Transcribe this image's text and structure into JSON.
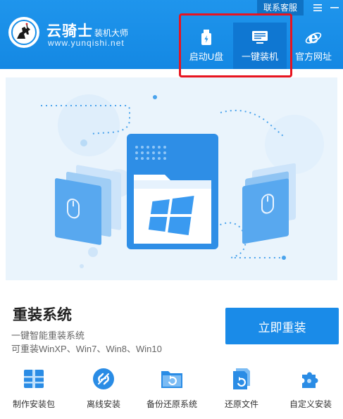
{
  "header": {
    "logo": {
      "name": "云骑士",
      "suffix": "装机大师",
      "url": "www.yunqishi.net"
    },
    "topbar": {
      "contact": "联系客服",
      "menu_icon": "menu-icon",
      "minimize_icon": "minimize-icon"
    },
    "nav": [
      {
        "label": "启动U盘",
        "icon": "usb-drive-icon"
      },
      {
        "label": "一键装机",
        "icon": "monitor-icon",
        "active": true
      },
      {
        "label": "官方网址",
        "icon": "ie-browser-icon"
      }
    ],
    "colors": {
      "header_bg": "#1a8fe8",
      "active_tab": "#0f77d2",
      "highlight": "#e8141f"
    }
  },
  "banner": {
    "illustration": "folder-with-windows-logo",
    "colors": {
      "bg": "#eaf4fc",
      "accent": "#2a8ce5"
    }
  },
  "main": {
    "title": "重装系统",
    "subtitle": "一键智能重装系统",
    "description": "可重装WinXP、Win7、Win8、Win10",
    "button_label": "立即重装",
    "colors": {
      "button": "#1a8be8"
    }
  },
  "tools": [
    {
      "label": "制作安装包",
      "icon": "package-icon"
    },
    {
      "label": "离线安装",
      "icon": "offline-icon"
    },
    {
      "label": "备份还原系统",
      "icon": "backup-restore-icon"
    },
    {
      "label": "还原文件",
      "icon": "restore-file-icon"
    },
    {
      "label": "自定义安装",
      "icon": "custom-puzzle-icon"
    }
  ]
}
